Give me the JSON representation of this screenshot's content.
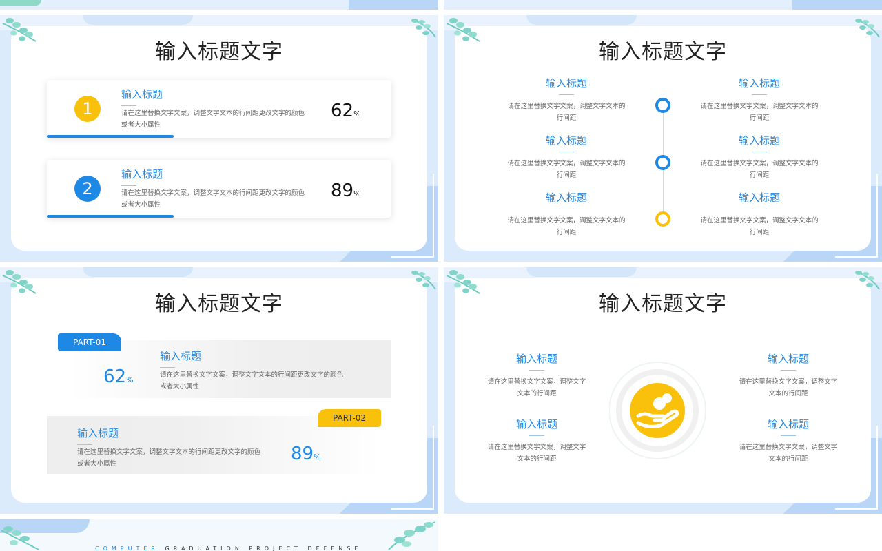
{
  "slide_title": "输入标题文字",
  "slide1": {
    "cards": [
      {
        "num": "1",
        "heading": "输入标题",
        "desc": "请在这里替换文字文案，调整文字文本的行间距更改文字的颜色或者大小属性",
        "value": "62",
        "unit": "%",
        "color": "#f9c10b"
      },
      {
        "num": "2",
        "heading": "输入标题",
        "desc": "请在这里替换文字文案，调整文字文本的行间距更改文字的颜色或者大小属性",
        "value": "89",
        "unit": "%",
        "color": "#1e88e5"
      }
    ]
  },
  "slide2": {
    "items": [
      {
        "heading": "输入标题",
        "desc": "请在这里替换文字文案，调整文字文本的行间距"
      },
      {
        "heading": "输入标题",
        "desc": "请在这里替换文字文案，调整文字文本的行间距"
      },
      {
        "heading": "输入标题",
        "desc": "请在这里替换文字文案，调整文字文本的行间距"
      },
      {
        "heading": "输入标题",
        "desc": "请在这里替换文字文案，调整文字文本的行间距"
      },
      {
        "heading": "输入标题",
        "desc": "请在这里替换文字文案，调整文字文本的行间距"
      },
      {
        "heading": "输入标题",
        "desc": "请在这里替换文字文案，调整文字文本的行间距"
      }
    ]
  },
  "slide3": {
    "parts": [
      {
        "tag": "PART-01",
        "value": "62",
        "unit": "%",
        "heading": "输入标题",
        "desc": "请在这里替换文字文案，调整文字文本的行间距更改文字的颜色或者大小属性"
      },
      {
        "tag": "PART-02",
        "value": "89",
        "unit": "%",
        "heading": "输入标题",
        "desc": "请在这里替换文字文案，调整文字文本的行间距更改文字的颜色或者大小属性"
      }
    ]
  },
  "slide4": {
    "items": [
      {
        "heading": "输入标题",
        "desc": "请在这里替换文字文案，调整文字文本的行间距"
      },
      {
        "heading": "输入标题",
        "desc": "请在这里替换文字文案，调整文字文本的行间距"
      },
      {
        "heading": "输入标题",
        "desc": "请在这里替换文字文案，调整文字文本的行间距"
      },
      {
        "heading": "输入标题",
        "desc": "请在这里替换文字文案，调整文字文本的行间距"
      }
    ]
  },
  "slide5": {
    "footer_word1": "COMPUTER",
    "footer_word2": "GRADUATION PROJECT DEFENSE"
  },
  "colors": {
    "blue": "#1e88e5",
    "yellow": "#f9c10b",
    "leaf": "#7fd3c8"
  }
}
